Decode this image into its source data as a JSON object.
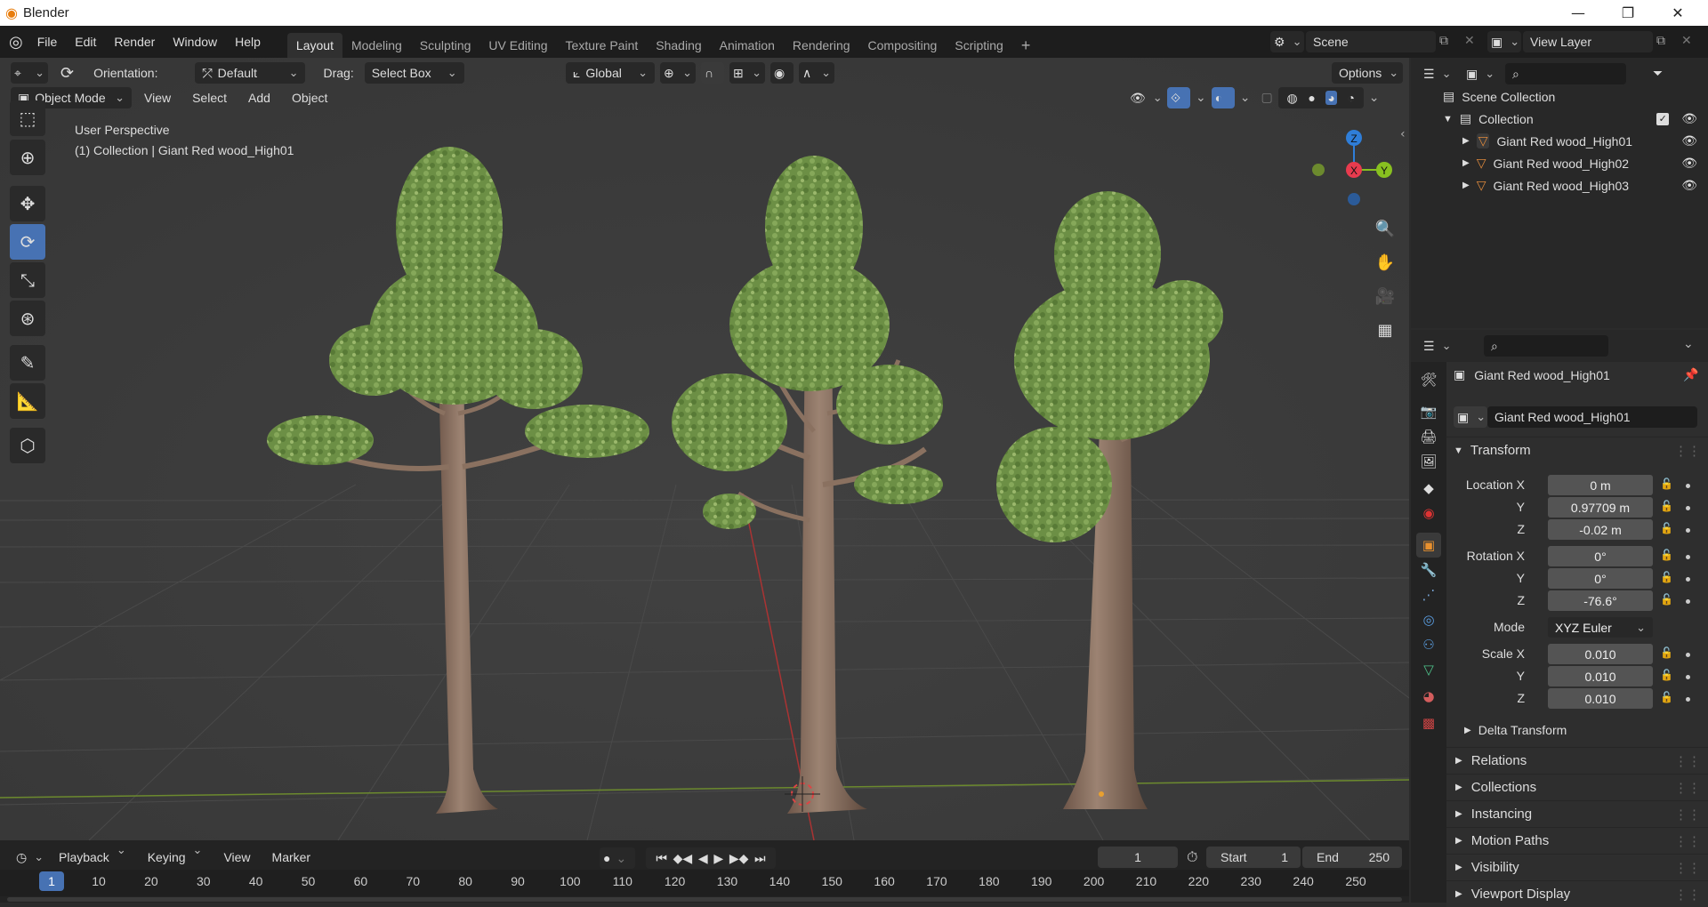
{
  "window": {
    "title": "Blender"
  },
  "menus": [
    "File",
    "Edit",
    "Render",
    "Window",
    "Help"
  ],
  "workspaces": [
    "Layout",
    "Modeling",
    "Sculpting",
    "UV Editing",
    "Texture Paint",
    "Shading",
    "Animation",
    "Rendering",
    "Compositing",
    "Scripting"
  ],
  "active_workspace": "Layout",
  "add_workspace": "+",
  "scene": {
    "name": "Scene"
  },
  "view_layer": {
    "name": "View Layer"
  },
  "tool_header": {
    "orientation_label": "Orientation:",
    "orientation_value": "Default",
    "drag_label": "Drag:",
    "drag_value": "Select Box",
    "transform_orientation": "Global",
    "options_label": "Options"
  },
  "vp_header": {
    "mode": "Object Mode",
    "menus": [
      "View",
      "Select",
      "Add",
      "Object"
    ]
  },
  "viewport": {
    "perspective": "User Perspective",
    "collection_info": "(1) Collection | Giant Red wood_High01",
    "gizmo": {
      "x": "X",
      "y": "Y",
      "z": "Z"
    }
  },
  "tools": [
    "select-box-icon",
    "cursor-icon",
    "move-icon",
    "rotate-icon",
    "scale-icon",
    "transform-icon",
    "annotate-icon",
    "measure-icon",
    "add-cube-icon"
  ],
  "active_tool": "rotate-icon",
  "outliner": {
    "root": "Scene Collection",
    "collection": "Collection",
    "objects": [
      "Giant Red wood_High01",
      "Giant Red wood_High02",
      "Giant Red wood_High03"
    ]
  },
  "properties": {
    "object_name": "Giant Red wood_High01",
    "data_name": "Giant Red wood_High01",
    "transform_title": "Transform",
    "location_label": "Location X",
    "rotation_label": "Rotation X",
    "scale_label": "Scale X",
    "axis_y": "Y",
    "axis_z": "Z",
    "location": [
      "0 m",
      "0.97709 m",
      "-0.02 m"
    ],
    "rotation": [
      "0°",
      "0°",
      "-76.6°"
    ],
    "mode_label": "Mode",
    "mode_value": "XYZ Euler",
    "scale": [
      "0.010",
      "0.010",
      "0.010"
    ],
    "delta_transform": "Delta Transform",
    "sections": [
      "Relations",
      "Collections",
      "Instancing",
      "Motion Paths",
      "Visibility",
      "Viewport Display"
    ]
  },
  "timeline": {
    "menus": [
      "Playback",
      "Keying",
      "View",
      "Marker"
    ],
    "current_frame": "1",
    "start_label": "Start",
    "start": "1",
    "end_label": "End",
    "end": "250",
    "ruler": [
      "1",
      "10",
      "20",
      "30",
      "40",
      "50",
      "60",
      "70",
      "80",
      "90",
      "100",
      "110",
      "120",
      "130",
      "140",
      "150",
      "160",
      "170",
      "180",
      "190",
      "200",
      "210",
      "220",
      "230",
      "240",
      "250"
    ]
  },
  "colors": {
    "accent": "#4772b3",
    "x_axis": "#e83b4e",
    "y_axis": "#88c020",
    "z_axis": "#2f7ed8",
    "foliage": "#6c8f45",
    "bark": "#8a6e5c"
  }
}
